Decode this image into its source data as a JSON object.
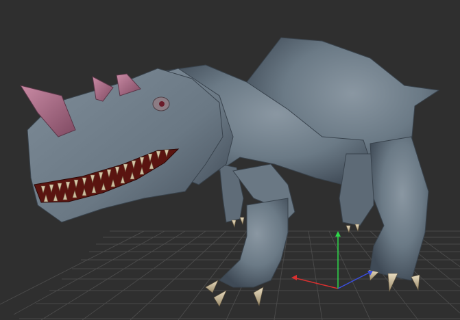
{
  "viewport": {
    "background_color": "#2f2f2f",
    "grid_color": "#4a4a4a",
    "axis_colors": {
      "x": "#d83030",
      "y": "#2fd84a",
      "z": "#3a4ee0"
    }
  },
  "model": {
    "name_icon": "dinosaur-model",
    "skin_color": "#6b7a86",
    "skin_shadow_color": "#3f4a56",
    "horn_color": "#b06a86",
    "mouth_color": "#5a1410",
    "teeth_color": "#d6c6a8",
    "claw_color": "#d8c8a4"
  }
}
